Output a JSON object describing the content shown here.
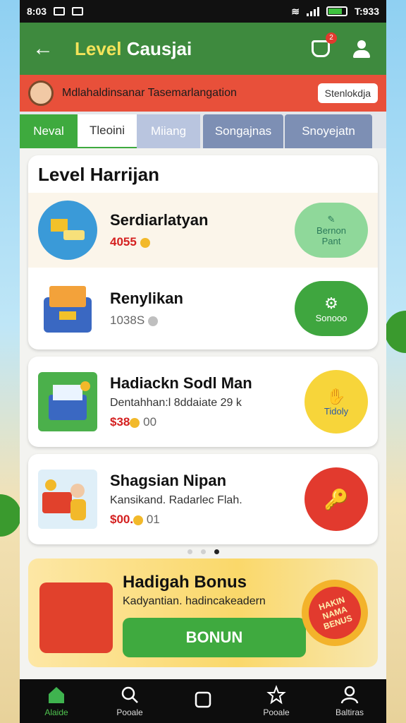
{
  "status_bar": {
    "time_left": "8:03",
    "time_right": "T:933"
  },
  "app_bar": {
    "title_part1": "Level",
    "title_part2": "Causjai",
    "notif_count": "2"
  },
  "banner": {
    "message": "Mdlahaldinsanar Tasemarlangation",
    "button": "Stenlokdja"
  },
  "tabs": [
    "Neval",
    "Tleoini",
    "Miiang",
    "Songajnas",
    "Snoyejatn"
  ],
  "level_section": {
    "title": "Level Harrijan",
    "items": [
      {
        "name": "Serdiarlatyan",
        "price": "4055",
        "action_label_1": "Bernon",
        "action_label_2": "Pant"
      },
      {
        "name": "Renylikan",
        "price": "1038S",
        "action_label": "Sonooo"
      }
    ]
  },
  "cards": [
    {
      "name": "Hadiackn Sodl Man",
      "sub": "Dentahhan:l 8ddaiate 29 k",
      "price_red": "$38",
      "price_grey": "00",
      "button_label": "Tidoly"
    },
    {
      "name": "Shagsian Nipan",
      "sub": "Kansikand. Radarlec Flah.",
      "price_red": "$00.",
      "price_grey": "01"
    }
  ],
  "bonus": {
    "title": "Hadigah Bonus",
    "subtitle": "Kadyantian. hadincakeadern",
    "button": "BONUN",
    "badge": "HAKIN NAMA BENUS"
  },
  "nav": [
    {
      "label": "Alaide"
    },
    {
      "label": "Pooale"
    },
    {
      "label": ""
    },
    {
      "label": "Pooale"
    },
    {
      "label": "Baltiras"
    }
  ],
  "colors": {
    "appbar": "#3e8a3e",
    "banner": "#e8503a",
    "accent_green": "#3eaa3e",
    "price_red": "#d42020"
  }
}
